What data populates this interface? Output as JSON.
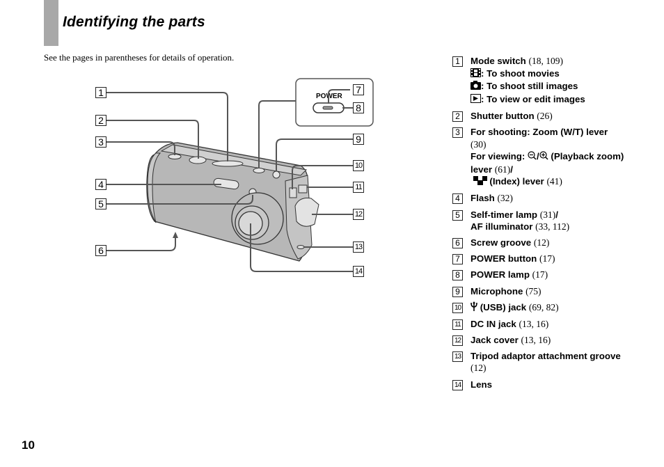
{
  "page": {
    "title": "Identifying the parts",
    "subtitle": "See the pages in parentheses for details of operation.",
    "page_number": "10"
  },
  "diagram": {
    "power_label": "POWER",
    "callouts": [
      "1",
      "2",
      "3",
      "4",
      "5",
      "6",
      "7",
      "8",
      "9",
      "10",
      "11",
      "12",
      "13",
      "14"
    ]
  },
  "parts": [
    {
      "num": "1",
      "name": "Mode switch",
      "ref": "(18, 109)",
      "sub": [
        {
          "icon": "movie-icon",
          "text": ": To shoot movies"
        },
        {
          "icon": "camera-icon",
          "text": ": To shoot still images"
        },
        {
          "icon": "playback-icon",
          "text": ": To view or edit images"
        }
      ]
    },
    {
      "num": "2",
      "name": "Shutter button",
      "ref": "(26)"
    },
    {
      "num": "3",
      "name": "For shooting: Zoom (W/T) lever",
      "ref": "(30)",
      "line2_prefix": "For viewing: ",
      "line2_icons": "zoom-out-icon / zoom-in-icon",
      "line2_text": " (Playback zoom) lever",
      "line2_ref": "(61)",
      "line2_suffix": "/",
      "line3_icon": "index-icon",
      "line3_text": " (Index) lever",
      "line3_ref": "(41)"
    },
    {
      "num": "4",
      "name": "Flash",
      "ref": "(32)"
    },
    {
      "num": "5",
      "name": "Self-timer lamp",
      "ref": "(31)",
      "suffix": "/",
      "line2_text": "AF illuminator",
      "line2_ref": "(33, 112)"
    },
    {
      "num": "6",
      "name": "Screw groove",
      "ref": "(12)"
    },
    {
      "num": "7",
      "name": "POWER button",
      "ref": "(17)"
    },
    {
      "num": "8",
      "name": "POWER lamp",
      "ref": "(17)"
    },
    {
      "num": "9",
      "name": "Microphone",
      "ref": "(75)"
    },
    {
      "num": "10",
      "icon": "usb-icon",
      "name": " (USB) jack",
      "ref": "(69, 82)"
    },
    {
      "num": "11",
      "name": "DC IN jack",
      "ref": "(13, 16)"
    },
    {
      "num": "12",
      "name": "Jack cover",
      "ref": "(13, 16)"
    },
    {
      "num": "13",
      "name": "Tripod adaptor attachment groove",
      "ref": "(12)"
    },
    {
      "num": "14",
      "name": "Lens",
      "ref": ""
    }
  ]
}
